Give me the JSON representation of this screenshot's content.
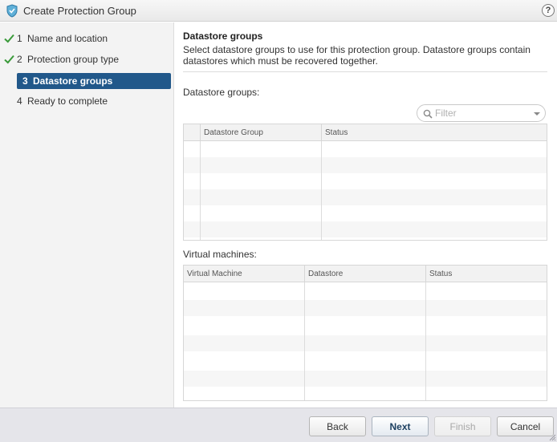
{
  "window": {
    "title": "Create Protection Group",
    "help_label": "?"
  },
  "steps": [
    {
      "num": "1",
      "label": "Name and location",
      "done": true
    },
    {
      "num": "2",
      "label": "Protection group type",
      "done": true
    },
    {
      "num": "3",
      "label": "Datastore groups",
      "active": true
    },
    {
      "num": "4",
      "label": "Ready to complete"
    }
  ],
  "content": {
    "heading": "Datastore groups",
    "description": "Select datastore groups to use for this protection group. Datastore groups contain datastores which must be recovered together.",
    "datastore_section_label": "Datastore groups:",
    "filter_placeholder": "Filter",
    "datastore_table": {
      "columns": [
        "Datastore Group",
        "Status"
      ],
      "rows": []
    },
    "vm_section_label": "Virtual machines:",
    "vm_table": {
      "columns": [
        "Virtual Machine",
        "Datastore",
        "Status"
      ],
      "rows": []
    }
  },
  "buttons": {
    "back": "Back",
    "next": "Next",
    "finish": "Finish",
    "cancel": "Cancel"
  },
  "colors": {
    "accent": "#21588a",
    "check": "#3a9a3a"
  }
}
